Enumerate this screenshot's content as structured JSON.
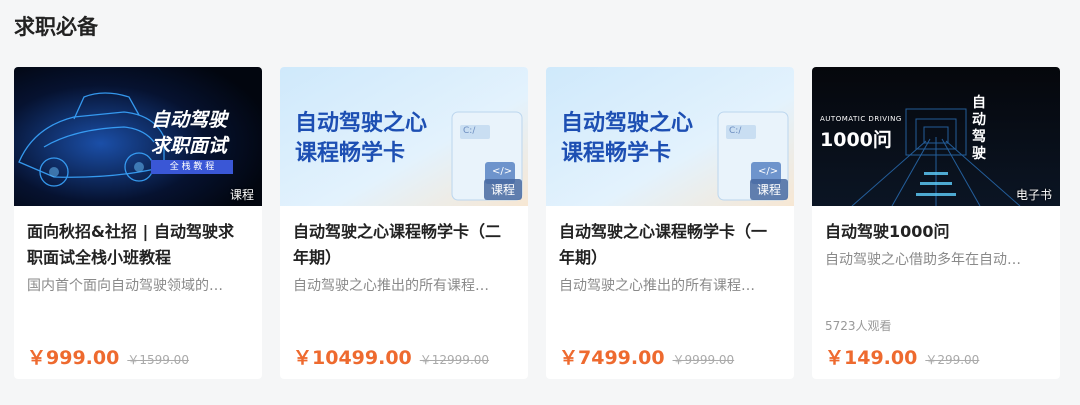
{
  "section": {
    "title": "求职必备"
  },
  "cards": [
    {
      "thumb_lines": [
        "自动驾驶",
        "求职面试",
        "全 栈 教 程"
      ],
      "type_tag": "课程",
      "title": "面向秋招&社招 | 自动驾驶求职面试全栈小班教程",
      "desc": "国内首个面向自动驾驶领域的…",
      "views": "",
      "price": "￥999.00",
      "orig_price": "￥1599.00"
    },
    {
      "thumb_lines": [
        "自动驾驶之心",
        "课程畅学卡",
        "C:/",
        "</>"
      ],
      "type_tag": "课程",
      "title": "自动驾驶之心课程畅学卡（二年期）",
      "desc": "自动驾驶之心推出的所有课程…",
      "views": "",
      "price": "￥10499.00",
      "orig_price": "￥12999.00"
    },
    {
      "thumb_lines": [
        "自动驾驶之心",
        "课程畅学卡",
        "C:/",
        "</>"
      ],
      "type_tag": "课程",
      "title": "自动驾驶之心课程畅学卡（一年期）",
      "desc": "自动驾驶之心推出的所有课程…",
      "views": "",
      "price": "￥7499.00",
      "orig_price": "￥9999.00"
    },
    {
      "thumb_lines": [
        "AUTOMATIC DRIVING",
        "1000问",
        "自动驾驶"
      ],
      "type_tag": "电子书",
      "title": "自动驾驶1000问",
      "desc": "自动驾驶之心借助多年在自动…",
      "views": "5723人观看",
      "price": "￥149.00",
      "orig_price": "￥299.00"
    }
  ]
}
